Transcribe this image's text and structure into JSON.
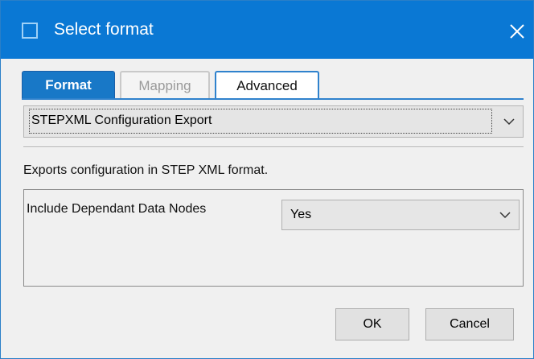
{
  "window": {
    "title": "Select format",
    "accent_color": "#0a78d4",
    "icons": {
      "window": "window-icon",
      "close": "close-icon"
    }
  },
  "tabs": [
    {
      "label": "Format",
      "state": "active"
    },
    {
      "label": "Mapping",
      "state": "disabled"
    },
    {
      "label": "Advanced",
      "state": "normal"
    }
  ],
  "format": {
    "selected": "STEPXML Configuration Export",
    "description": "Exports configuration in STEP XML format."
  },
  "parameters": [
    {
      "label": "Include Dependant Data Nodes",
      "value": "Yes"
    }
  ],
  "buttons": {
    "ok": "OK",
    "cancel": "Cancel"
  }
}
